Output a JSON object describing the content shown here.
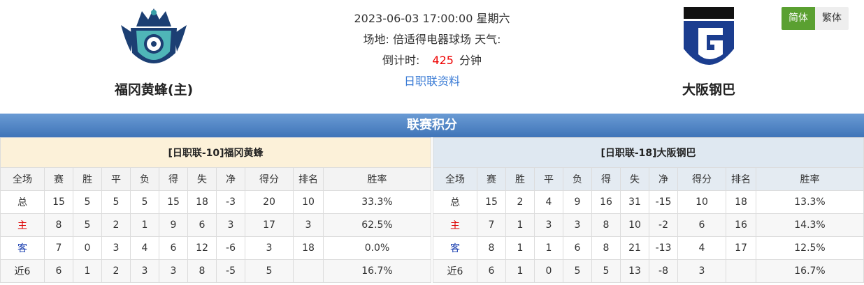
{
  "match": {
    "datetime": "2023-06-03 17:00:00 星期六",
    "venue_line": "场地:  倍适得电器球场  天气:",
    "countdown_label": "倒计时:",
    "countdown_value": "425",
    "countdown_unit": "分钟",
    "league_link": "日职联资料"
  },
  "home_team": {
    "name": "福冈黄蜂(主)",
    "logo_icon": "avispa-fukuoka-crest-icon"
  },
  "away_team": {
    "name": "大阪钢巴",
    "logo_icon": "gamba-osaka-g-logo-icon"
  },
  "lang": {
    "simplified": "简体",
    "traditional": "繁体"
  },
  "standings": {
    "title": "联赛积分",
    "columns": [
      "全场",
      "赛",
      "胜",
      "平",
      "负",
      "得",
      "失",
      "净",
      "得分",
      "排名",
      "胜率"
    ],
    "home": {
      "caption": "[日职联-10]福冈黄蜂",
      "rows": [
        [
          "总",
          "15",
          "5",
          "5",
          "5",
          "15",
          "18",
          "-3",
          "20",
          "10",
          "33.3%"
        ],
        [
          "主",
          "8",
          "5",
          "2",
          "1",
          "9",
          "6",
          "3",
          "17",
          "3",
          "62.5%"
        ],
        [
          "客",
          "7",
          "0",
          "3",
          "4",
          "6",
          "12",
          "-6",
          "3",
          "18",
          "0.0%"
        ],
        [
          "近6",
          "6",
          "1",
          "2",
          "3",
          "3",
          "8",
          "-5",
          "5",
          "",
          "16.7%"
        ]
      ]
    },
    "away": {
      "caption": "[日职联-18]大阪钢巴",
      "rows": [
        [
          "总",
          "15",
          "2",
          "4",
          "9",
          "16",
          "31",
          "-15",
          "10",
          "18",
          "13.3%"
        ],
        [
          "主",
          "7",
          "1",
          "3",
          "3",
          "8",
          "10",
          "-2",
          "6",
          "16",
          "14.3%"
        ],
        [
          "客",
          "8",
          "1",
          "1",
          "6",
          "8",
          "21",
          "-13",
          "4",
          "17",
          "12.5%"
        ],
        [
          "近6",
          "6",
          "1",
          "0",
          "5",
          "5",
          "13",
          "-8",
          "3",
          "",
          "16.7%"
        ]
      ]
    }
  }
}
